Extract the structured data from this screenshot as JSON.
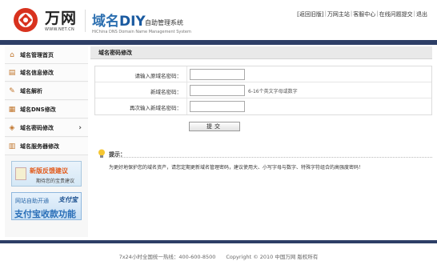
{
  "header": {
    "logo_text": "万网",
    "logo_url_text": "WWW.NET.CN",
    "system_name_cn": "域名",
    "system_name_diy": "DIY",
    "system_name_side": "自助管理系统",
    "system_name_en": "HiChina DNS Domain Name Management System",
    "links": [
      "[返回旧版]",
      "万网主站",
      "客服中心",
      "在线问题提交",
      "退出"
    ],
    "link_separator": "|"
  },
  "sidebar": {
    "items": [
      {
        "label": "域名管理首页",
        "icon": "home-icon"
      },
      {
        "label": "域名信息修改",
        "icon": "info-icon"
      },
      {
        "label": "域名解析",
        "icon": "resolve-icon"
      },
      {
        "label": "域名DNS修改",
        "icon": "dns-icon"
      },
      {
        "label": "域名密码修改",
        "icon": "lock-icon",
        "active": true
      },
      {
        "label": "域名服务器修改",
        "icon": "server-icon"
      }
    ],
    "promo_feedback": {
      "title": "新版反馈建议",
      "subtitle": "期待您的宝贵建议"
    },
    "promo_alipay": {
      "top": "网站自助开通",
      "brand": "支付宝",
      "main": "支付宝收款功能"
    }
  },
  "main": {
    "title": "域名密码修改",
    "form": {
      "rows": [
        {
          "label": "请输入原域名密码：",
          "value": "",
          "hint": ""
        },
        {
          "label": "新域名密码：",
          "value": "",
          "hint": "6-16个英文字母或数字"
        },
        {
          "label": "再次输入新域名密码：",
          "value": "",
          "hint": ""
        }
      ],
      "submit_label": "提交"
    },
    "tip": {
      "title": "提示：",
      "text": "为更好地保护您的域名资产，请您定期更新域名管理密码，建议使用大、小写字母与数字、特殊字符组合的高强度密码！"
    }
  },
  "footer": {
    "text": "7x24小时全国统一热线：400-600-8500　　Copyright © 2010 中国万网  版权所有"
  },
  "colors": {
    "accent_bar": "#2d3e66",
    "brand_blue": "#2c6fb0",
    "promo_orange": "#e35a1a"
  }
}
